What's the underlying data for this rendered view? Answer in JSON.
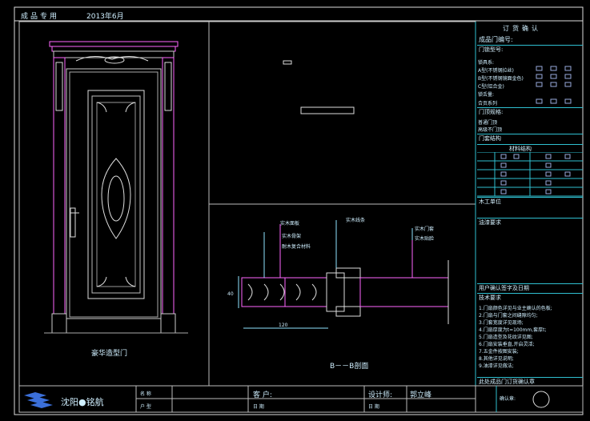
{
  "header": {
    "left_label": "成品专用",
    "date": "2013年6月"
  },
  "door": {
    "caption": "豪华造型门"
  },
  "section": {
    "label": "B－－B剖面",
    "dim_horizontal": "120",
    "dim_vertical": "40",
    "callouts": [
      "实木面板",
      "实木骨架",
      "耐木复合材料",
      "实木线条",
      "实木门套",
      "实木贴脸"
    ]
  },
  "titleblock": {
    "heading": "订货确认",
    "door_no_label": "成品门编号:",
    "rows": [
      "门锁型号:",
      "锁具系:",
      "A型(不锈钢拉丝)",
      "B型(不锈钢镜面金色)",
      "C型(铝合金)",
      "锁舌量:",
      "合页系列",
      "门顶规格:",
      "普通门顶",
      "高级不门顶",
      "门套结构",
      "材料结构",
      "木工单位",
      "油漆要求",
      "用户确认签字及日期",
      "技术要求"
    ],
    "tech_notes": [
      "1.门扇颜色详见与业主确认的色板;",
      "2.门扇与门套之间缝隙均匀;",
      "3.门套宽度详见现场;",
      "4.门扇厚度为t=100mm,套厚t;",
      "5.门扇造型及花纹详见图;",
      "6.门扇安装垂直,开启灵活;",
      "7.五金件按图安装;",
      "8.其他详见说明;",
      "9.油漆详见做法;"
    ],
    "footer_note": "此处成品门订货确认章",
    "stamp_label": "确认章:"
  },
  "bottom_bar": {
    "company": "沈阳●铭航",
    "cell1_top": "名 称",
    "cell1_bottom": "户 型",
    "client_label": "客  户:",
    "client_bottom": "日 期",
    "designer_label": "设计师:",
    "designer_name": "郭立峰",
    "designer_bottom": "日 期"
  }
}
